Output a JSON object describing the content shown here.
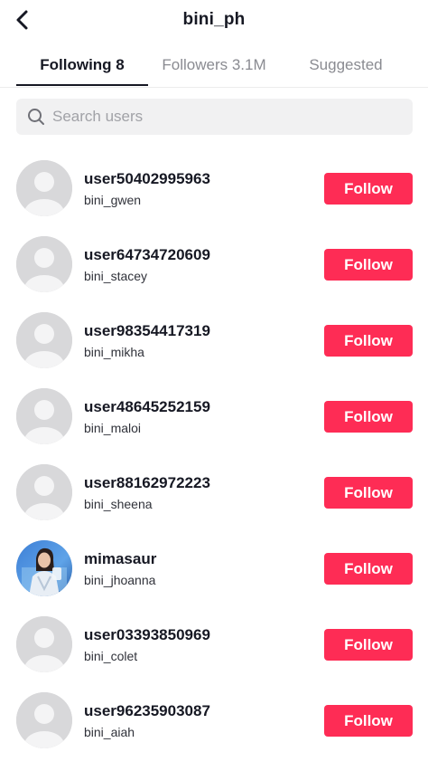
{
  "header": {
    "title": "bini_ph",
    "back_icon": "chevron-left-icon"
  },
  "tabs": [
    {
      "label": "Following 8",
      "active": true
    },
    {
      "label": "Followers 3.1M",
      "active": false
    },
    {
      "label": "Suggested",
      "active": false
    }
  ],
  "search": {
    "placeholder": "Search users",
    "value": "",
    "icon": "search-icon"
  },
  "users": [
    {
      "username": "user50402995963",
      "display": "bini_gwen",
      "avatar": "default-avatar",
      "button": "Follow"
    },
    {
      "username": "user64734720609",
      "display": "bini_stacey",
      "avatar": "default-avatar",
      "button": "Follow"
    },
    {
      "username": "user98354417319",
      "display": "bini_mikha",
      "avatar": "default-avatar",
      "button": "Follow"
    },
    {
      "username": "user48645252159",
      "display": "bini_maloi",
      "avatar": "default-avatar",
      "button": "Follow"
    },
    {
      "username": "user88162972223",
      "display": "bini_sheena",
      "avatar": "default-avatar",
      "button": "Follow"
    },
    {
      "username": "mimasaur",
      "display": "bini_jhoanna",
      "avatar": "photo-avatar",
      "button": "Follow"
    },
    {
      "username": "user03393850969",
      "display": "bini_colet",
      "avatar": "default-avatar",
      "button": "Follow"
    },
    {
      "username": "user96235903087",
      "display": "bini_aiah",
      "avatar": "default-avatar",
      "button": "Follow"
    }
  ],
  "colors": {
    "accent": "#fe2c55",
    "text": "#161823",
    "muted": "#8a8b91",
    "search_bg": "#f1f1f2",
    "avatar_bg": "#d8d8da"
  }
}
